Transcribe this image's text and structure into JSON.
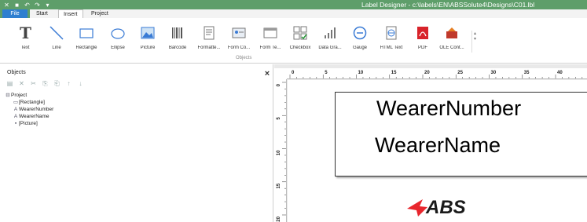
{
  "window": {
    "title": "Label Designer - c:\\labels\\EN\\ABSSolute4\\Designs\\C01.lbl",
    "quick_access": [
      "app-icon",
      "save-icon",
      "undo-icon",
      "redo-icon",
      "dropdown-icon"
    ]
  },
  "tabs": {
    "file": "File",
    "start": "Start",
    "insert": "Insert",
    "project": "Project",
    "active": "Insert"
  },
  "ribbon": {
    "group_label": "Objects",
    "items": [
      {
        "label": "Text",
        "icon": "text-icon"
      },
      {
        "label": "Line",
        "icon": "line-icon"
      },
      {
        "label": "Rectangle",
        "icon": "rectangle-icon"
      },
      {
        "label": "Ellipse",
        "icon": "ellipse-icon"
      },
      {
        "label": "Picture",
        "icon": "picture-icon"
      },
      {
        "label": "Barcode",
        "icon": "barcode-icon"
      },
      {
        "label": "Formatte...",
        "icon": "formatted-text-icon"
      },
      {
        "label": "Form Co...",
        "icon": "form-control-icon"
      },
      {
        "label": "Form Te...",
        "icon": "form-template-icon"
      },
      {
        "label": "Checkbox",
        "icon": "checkbox-icon"
      },
      {
        "label": "Data Gra...",
        "icon": "data-graph-icon"
      },
      {
        "label": "Gauge",
        "icon": "gauge-icon"
      },
      {
        "label": "HTML Text",
        "icon": "html-text-icon"
      },
      {
        "label": "PDF",
        "icon": "pdf-icon"
      },
      {
        "label": "OLE Cont...",
        "icon": "ole-container-icon"
      }
    ]
  },
  "objects_panel": {
    "title": "Objects",
    "close": "×",
    "tree": [
      {
        "label": "Project",
        "level": 0,
        "glyph": "⊟"
      },
      {
        "label": "[Rectangle]",
        "level": 1,
        "glyph": "▭"
      },
      {
        "label": "WearerNumber",
        "level": 1,
        "glyph": "A"
      },
      {
        "label": "WearerName",
        "level": 1,
        "glyph": "A"
      },
      {
        "label": "[Picture]",
        "level": 1,
        "glyph": "▪"
      }
    ]
  },
  "ruler": {
    "top_labels": [
      "0",
      "5",
      "10",
      "15",
      "20",
      "25",
      "30",
      "35",
      "40"
    ],
    "left_labels": [
      "0",
      "5",
      "10",
      "15",
      "20"
    ]
  },
  "label": {
    "line1": "WearerNumber",
    "line2": "WearerName",
    "logo_text": "ABS"
  },
  "colors": {
    "titlebar": "#5e9e6a",
    "file_tab": "#2f7fd0",
    "logo_red": "#e8262d"
  }
}
